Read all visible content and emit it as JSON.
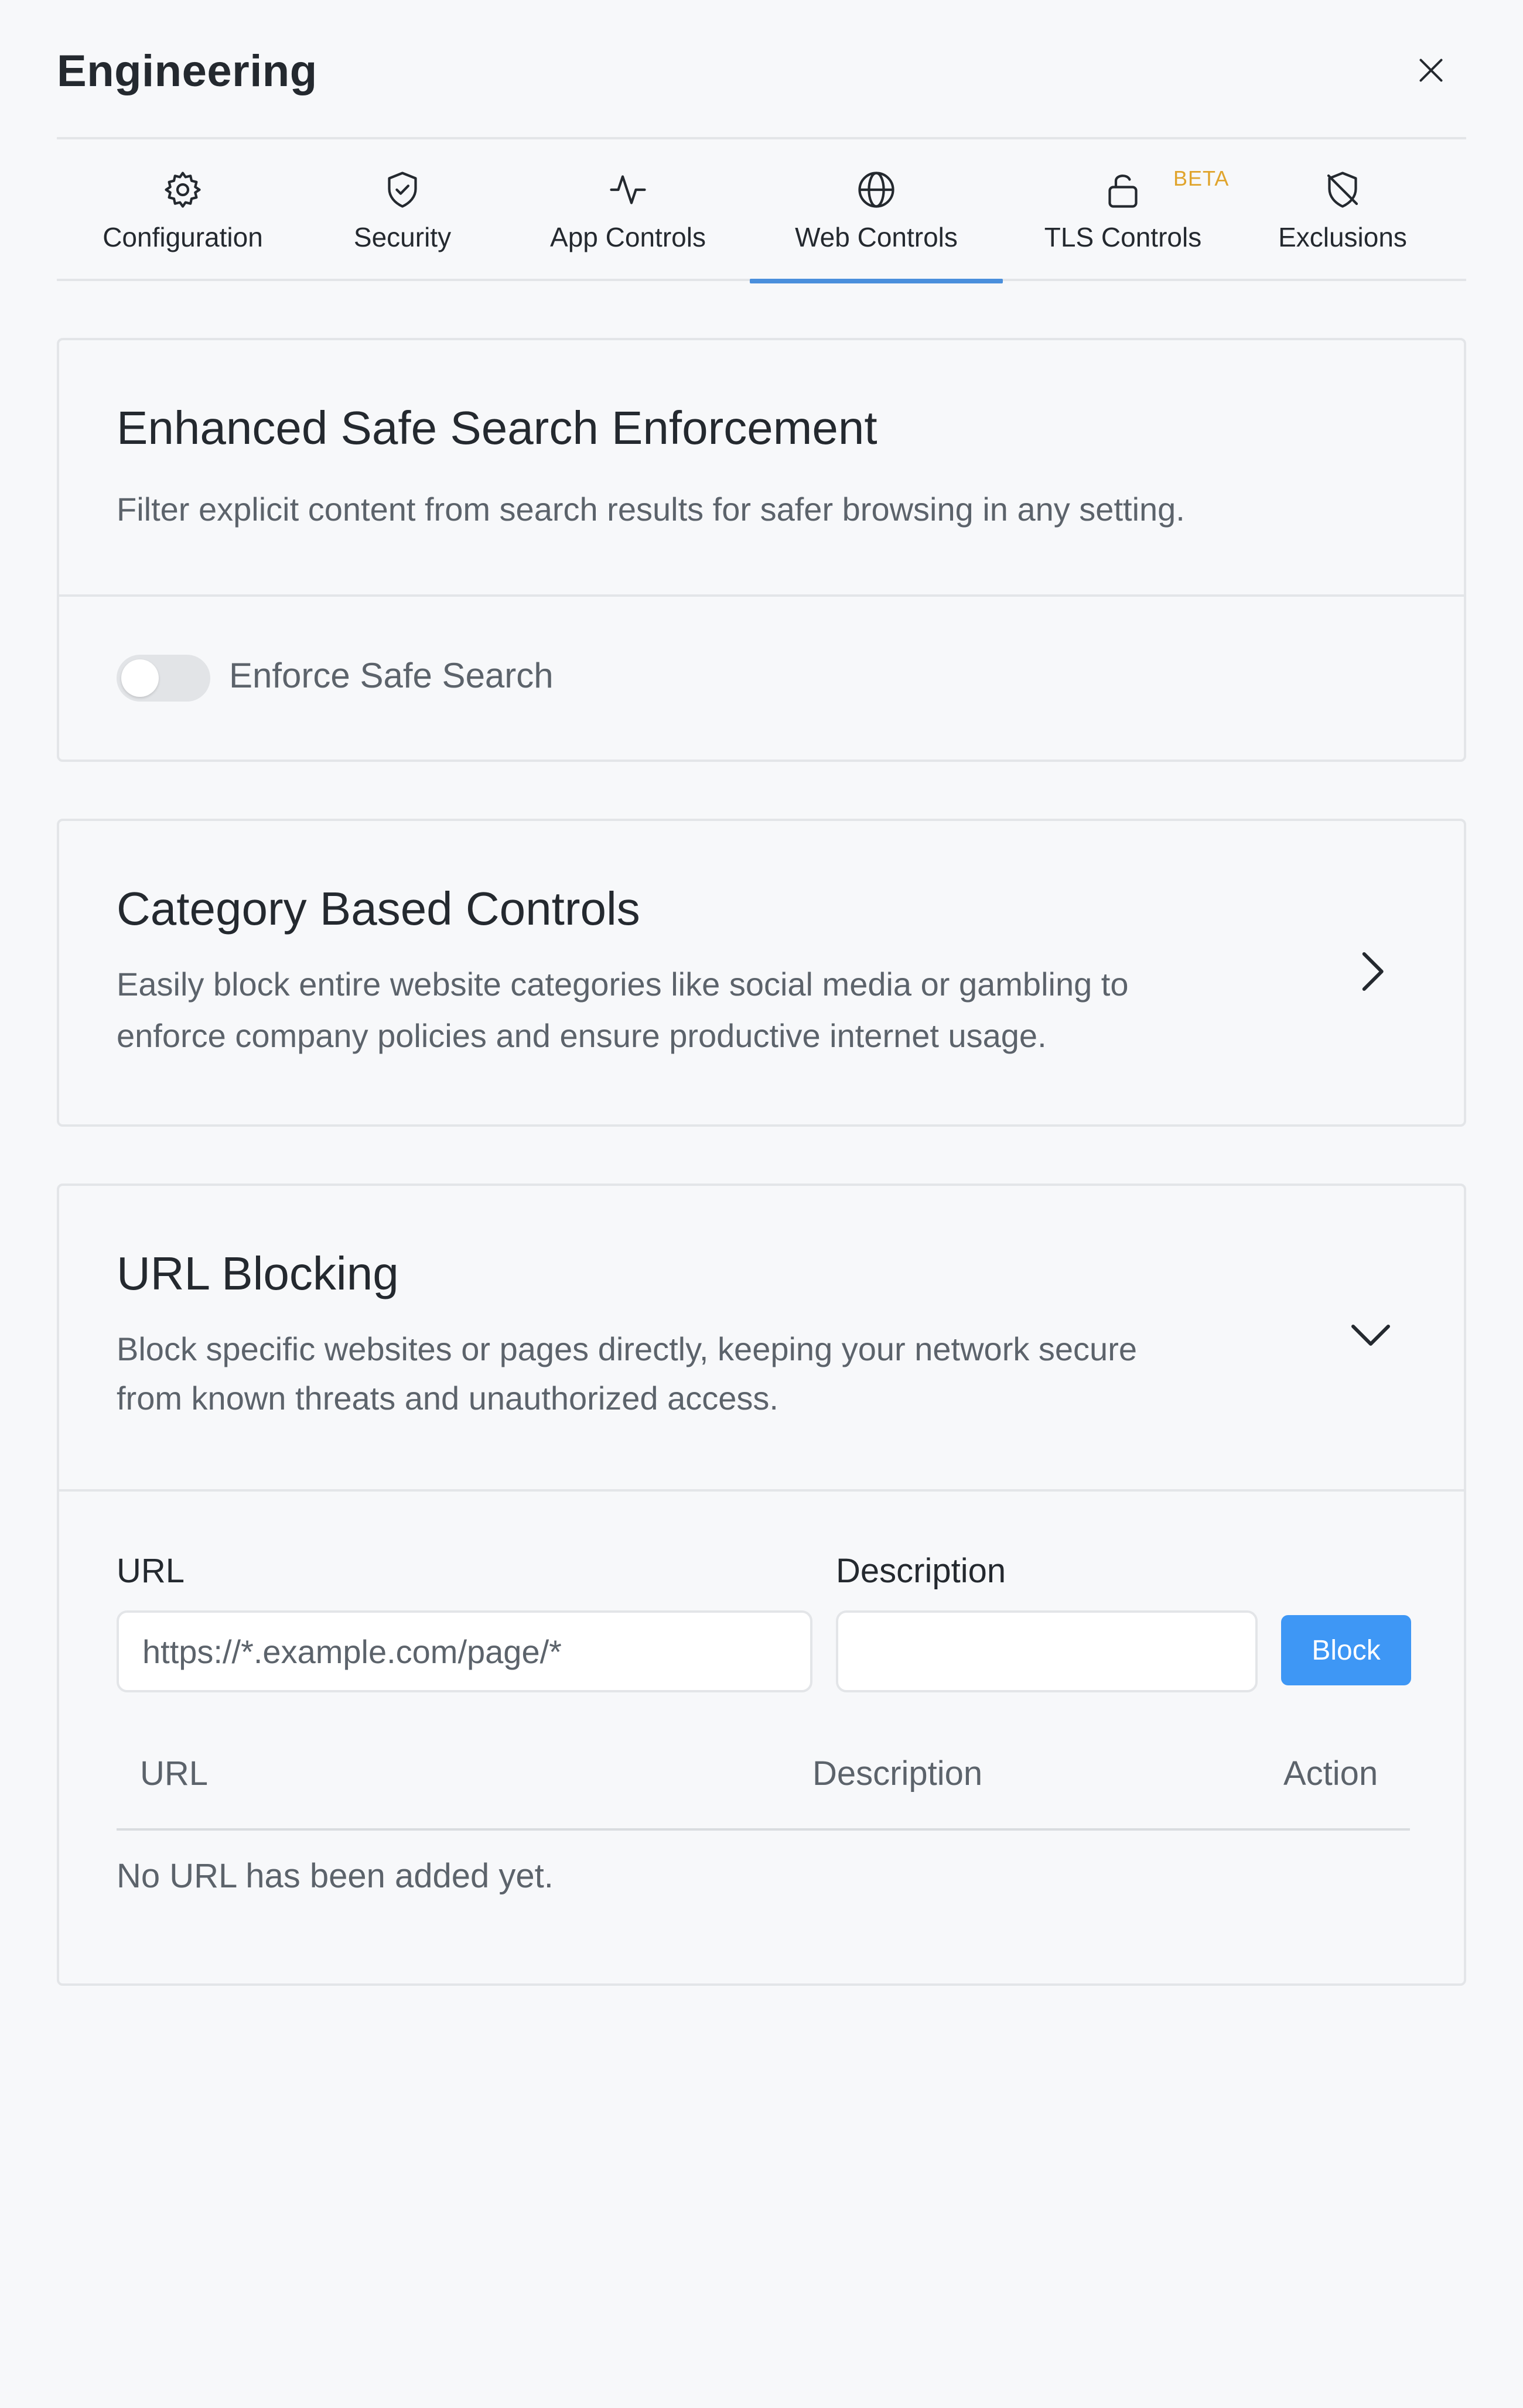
{
  "header": {
    "title": "Engineering",
    "close_icon": "close-icon"
  },
  "tabs": [
    {
      "label": "Configuration",
      "icon": "gear-icon",
      "active": false
    },
    {
      "label": "Security",
      "icon": "shield-check-icon",
      "active": false
    },
    {
      "label": "App Controls",
      "icon": "activity-icon",
      "active": false
    },
    {
      "label": "Web Controls",
      "icon": "globe-icon",
      "active": true
    },
    {
      "label": "TLS Controls",
      "icon": "unlock-icon",
      "active": false,
      "badge": "BETA"
    },
    {
      "label": "Exclusions",
      "icon": "shield-off-icon",
      "active": false
    }
  ],
  "safe_search": {
    "title": "Enhanced Safe Search Enforcement",
    "description": "Filter explicit content from search results for safer browsing in any setting.",
    "toggle_label": "Enforce Safe Search",
    "toggle_on": false
  },
  "category_controls": {
    "title": "Category Based Controls",
    "description_line1": "Easily block entire website categories like social media or gambling to",
    "description_line2": "enforce company policies and ensure productive internet usage.",
    "chevron": "chevron-right-icon"
  },
  "url_blocking": {
    "title": "URL Blocking",
    "description_line1": "Block specific websites or pages directly, keeping your network secure",
    "description_line2": "from known threats and unauthorized access.",
    "chevron": "chevron-down-icon",
    "form": {
      "url_label": "URL",
      "url_placeholder": "https://*.example.com/page/*",
      "url_value": "",
      "description_label": "Description",
      "description_placeholder": "",
      "description_value": "",
      "button_label": "Block"
    },
    "table": {
      "columns": [
        "URL",
        "Description",
        "Action"
      ],
      "rows": [],
      "empty_message": "No URL has been added yet."
    }
  },
  "colors": {
    "accent": "#4a8fdc",
    "button": "#3e97f5",
    "beta_badge": "#e0a42c",
    "background": "#f7f8fa",
    "border": "#e3e5e8"
  }
}
